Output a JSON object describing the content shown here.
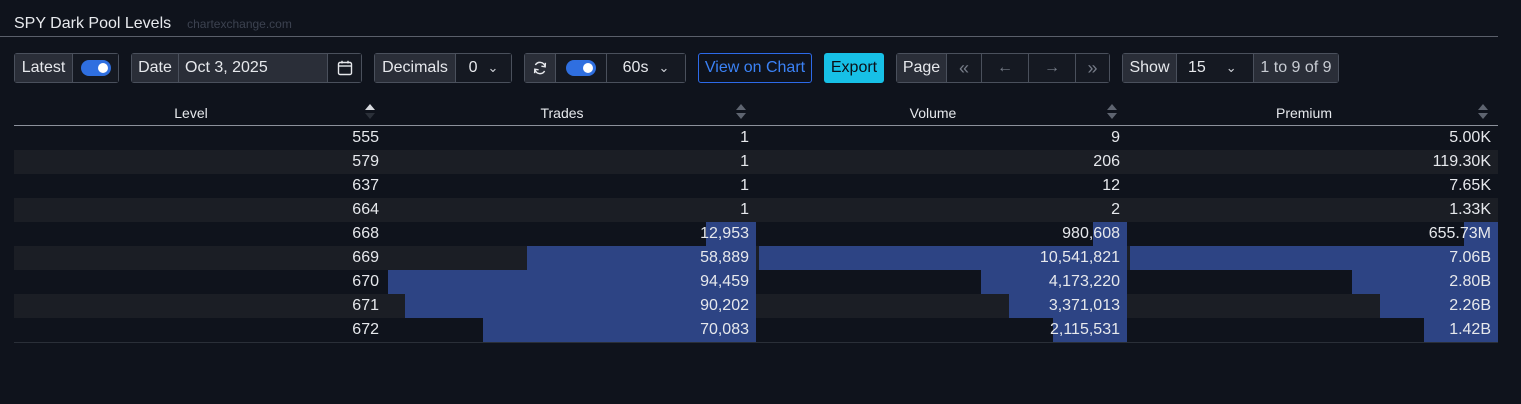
{
  "header": {
    "title": "SPY Dark Pool Levels",
    "source": "chartexchange.com"
  },
  "toolbar": {
    "latest_label": "Latest",
    "date_label": "Date",
    "date_value": "Oct 3, 2025",
    "decimals_label": "Decimals",
    "decimals_value": "0",
    "refresh_interval": "60s",
    "view_on_chart": "View on Chart",
    "export": "Export",
    "page_label": "Page",
    "page_first": "«",
    "page_prev": "←",
    "page_next": "→",
    "page_last": "»",
    "show_label": "Show",
    "show_value": "15",
    "range_text": "1 to 9 of 9"
  },
  "table": {
    "columns": [
      "Level",
      "Trades",
      "Volume",
      "Premium"
    ],
    "sorted_column": "Level",
    "bar_color": "#2d4484",
    "rows": [
      {
        "level": "555",
        "trades": "1",
        "volume": "9",
        "premium": "5.00K",
        "trades_n": 1,
        "volume_n": 9,
        "premium_n": 5000
      },
      {
        "level": "579",
        "trades": "1",
        "volume": "206",
        "premium": "119.30K",
        "trades_n": 1,
        "volume_n": 206,
        "premium_n": 119300
      },
      {
        "level": "637",
        "trades": "1",
        "volume": "12",
        "premium": "7.65K",
        "trades_n": 1,
        "volume_n": 12,
        "premium_n": 7650
      },
      {
        "level": "664",
        "trades": "1",
        "volume": "2",
        "premium": "1.33K",
        "trades_n": 1,
        "volume_n": 2,
        "premium_n": 1330
      },
      {
        "level": "668",
        "trades": "12,953",
        "volume": "980,608",
        "premium": "655.73M",
        "trades_n": 12953,
        "volume_n": 980608,
        "premium_n": 655730000
      },
      {
        "level": "669",
        "trades": "58,889",
        "volume": "10,541,821",
        "premium": "7.06B",
        "trades_n": 58889,
        "volume_n": 10541821,
        "premium_n": 7060000000
      },
      {
        "level": "670",
        "trades": "94,459",
        "volume": "4,173,220",
        "premium": "2.80B",
        "trades_n": 94459,
        "volume_n": 4173220,
        "premium_n": 2800000000
      },
      {
        "level": "671",
        "trades": "90,202",
        "volume": "3,371,013",
        "premium": "2.26B",
        "trades_n": 90202,
        "volume_n": 3371013,
        "premium_n": 2260000000
      },
      {
        "level": "672",
        "trades": "70,083",
        "volume": "2,115,531",
        "premium": "1.42B",
        "trades_n": 70083,
        "volume_n": 2115531,
        "premium_n": 1420000000
      }
    ]
  }
}
